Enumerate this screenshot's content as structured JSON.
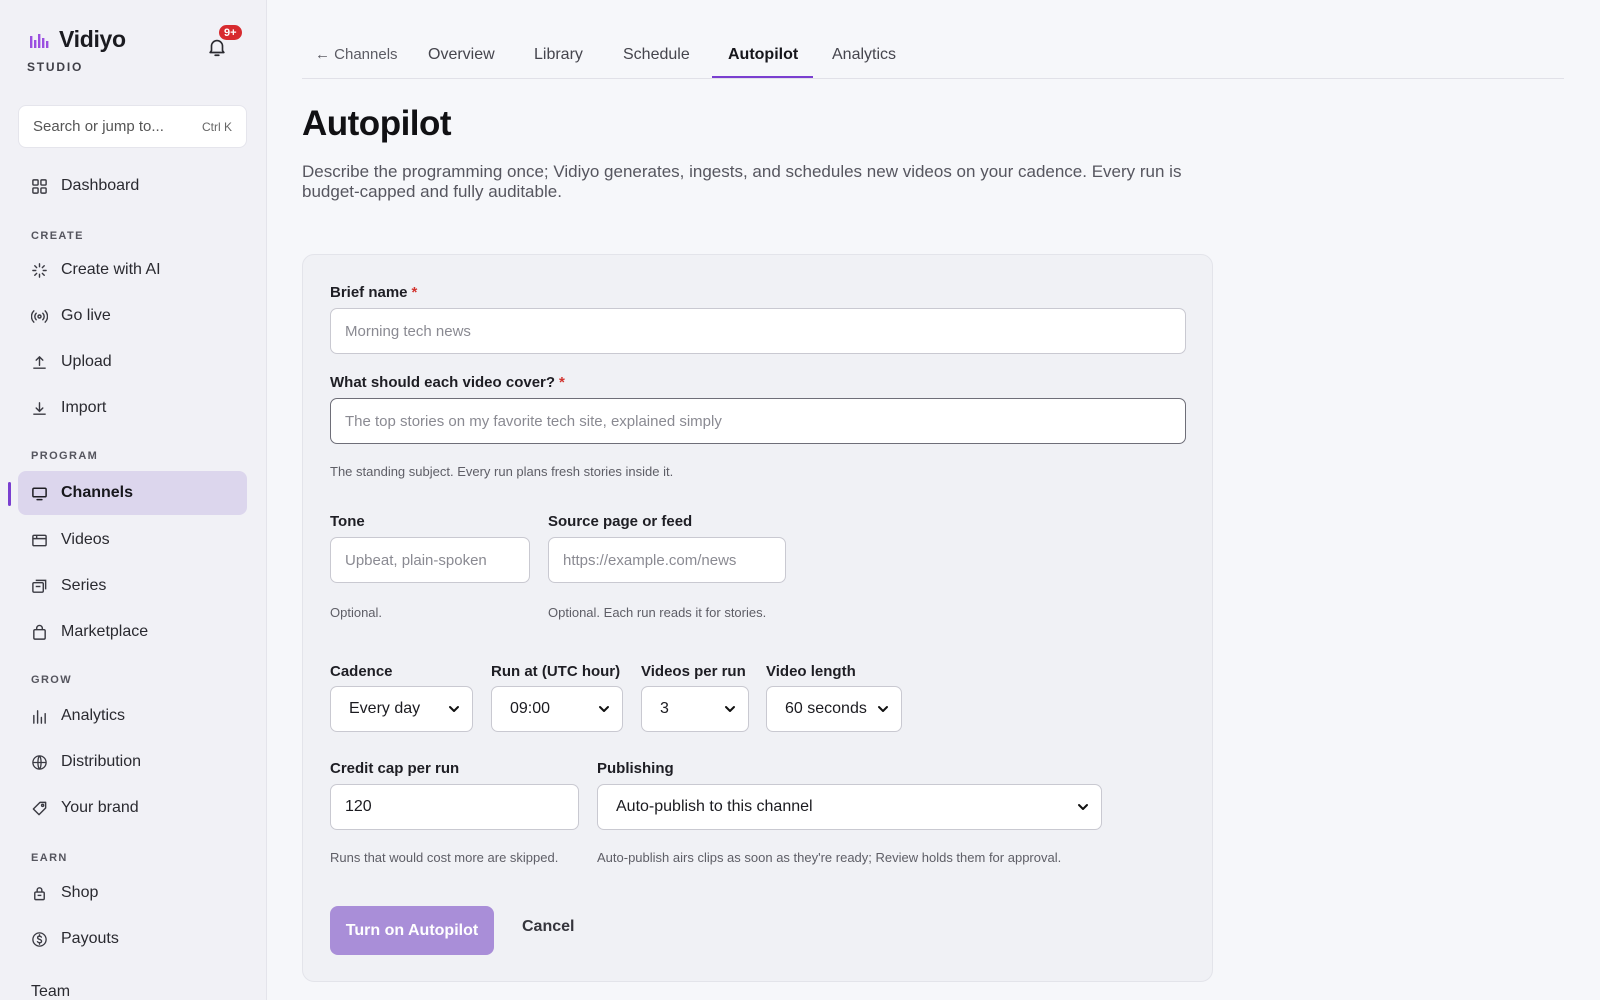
{
  "brand": {
    "name": "Vidiyo",
    "sub": "STUDIO",
    "notification_count": "9+"
  },
  "search": {
    "placeholder": "Search or jump to...",
    "shortcut": "Ctrl K"
  },
  "sidebar": {
    "dashboard": "Dashboard",
    "sections": {
      "create": "CREATE",
      "program": "PROGRAM",
      "grow": "GROW",
      "earn": "EARN"
    },
    "create_items": [
      "Create with AI",
      "Go live",
      "Upload",
      "Import"
    ],
    "program_items": [
      "Channels",
      "Videos",
      "Series",
      "Marketplace"
    ],
    "grow_items": [
      "Analytics",
      "Distribution",
      "Your brand"
    ],
    "earn_items": [
      "Shop",
      "Payouts"
    ],
    "team": "Team",
    "active_item": "Channels"
  },
  "tabs": {
    "back": "← Channels",
    "items": [
      "Overview",
      "Library",
      "Schedule",
      "Autopilot",
      "Analytics"
    ],
    "active": "Autopilot"
  },
  "page": {
    "title": "Autopilot",
    "description": "Describe the programming once; Vidiyo generates, ingests, and schedules new videos on your cadence. Every run is budget-capped and fully auditable."
  },
  "form": {
    "brief_name": {
      "label": "Brief name",
      "placeholder": "Morning tech news"
    },
    "cover": {
      "label": "What should each video cover?",
      "placeholder": "The top stories on my favorite tech site, explained simply",
      "help": "The standing subject. Every run plans fresh stories inside it."
    },
    "tone": {
      "label": "Tone",
      "placeholder": "Upbeat, plain-spoken",
      "help": "Optional."
    },
    "source": {
      "label": "Source page or feed",
      "placeholder": "https://example.com/news",
      "help": "Optional. Each run reads it for stories."
    },
    "cadence": {
      "label": "Cadence",
      "value": "Every day"
    },
    "run_at": {
      "label": "Run at (UTC hour)",
      "value": "09:00"
    },
    "videos_per_run": {
      "label": "Videos per run",
      "value": "3"
    },
    "video_length": {
      "label": "Video length",
      "value": "60 seconds"
    },
    "credit_cap": {
      "label": "Credit cap per run",
      "value": "120",
      "help": "Runs that would cost more are skipped."
    },
    "publishing": {
      "label": "Publishing",
      "value": "Auto-publish to this channel",
      "help": "Auto-publish airs clips as soon as they're ready; Review holds them for approval."
    },
    "required_mark": "*",
    "submit": "Turn on Autopilot",
    "cancel": "Cancel"
  },
  "colors": {
    "accent": "#7a3fd0",
    "button": "#a98ed8",
    "badge": "#d72a2f"
  }
}
